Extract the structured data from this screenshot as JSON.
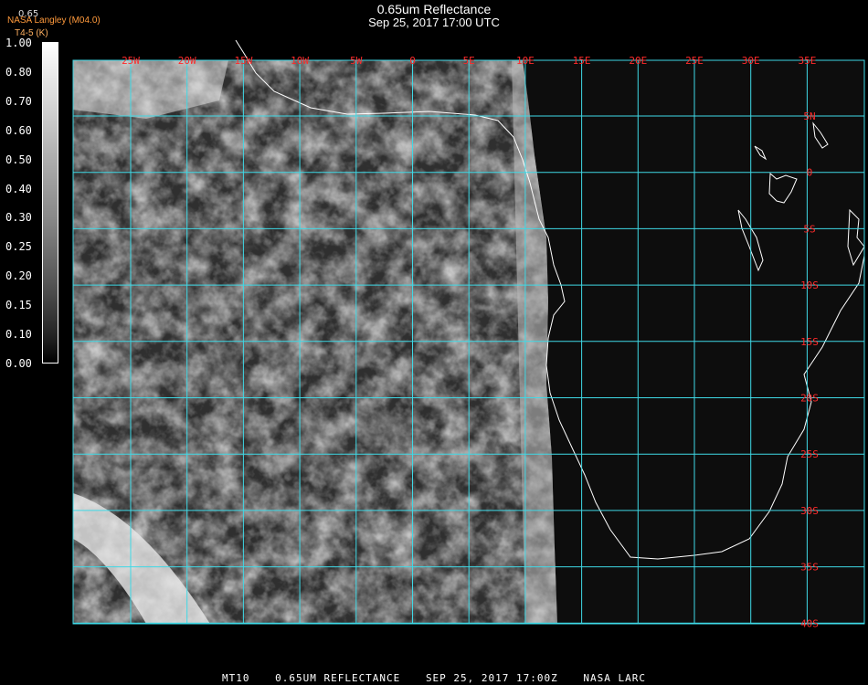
{
  "header": {
    "title": "0.65um Reflectance",
    "subtitle": "Sep 25, 2017 17:00 UTC",
    "credit": "NASA Langley (M04.0)",
    "credit_units": "T4-5 (K)",
    "legend_value": "0.65"
  },
  "colorbar": {
    "labels": [
      "1.00",
      "0.80",
      "0.70",
      "0.60",
      "0.50",
      "0.40",
      "0.30",
      "0.25",
      "0.20",
      "0.15",
      "0.10",
      "0.00"
    ]
  },
  "map": {
    "lon_labels": [
      "25W",
      "20W",
      "15W",
      "10W",
      "5W",
      "0",
      "5E",
      "10E",
      "15E",
      "20E",
      "25E",
      "30E",
      "35E"
    ],
    "lat_labels": [
      "5N",
      "0",
      "5S",
      "10S",
      "15S",
      "20S",
      "25S",
      "30S",
      "35S",
      "40S"
    ],
    "grid_color": "#3fd9e6",
    "label_color": "#ff2a2a",
    "coast_color": "#ffffff"
  },
  "footer": {
    "satellite": "MT10",
    "product": "0.65UM REFLECTANCE",
    "date": "SEP 25, 2017 17:00Z",
    "source": "NASA LARC"
  }
}
